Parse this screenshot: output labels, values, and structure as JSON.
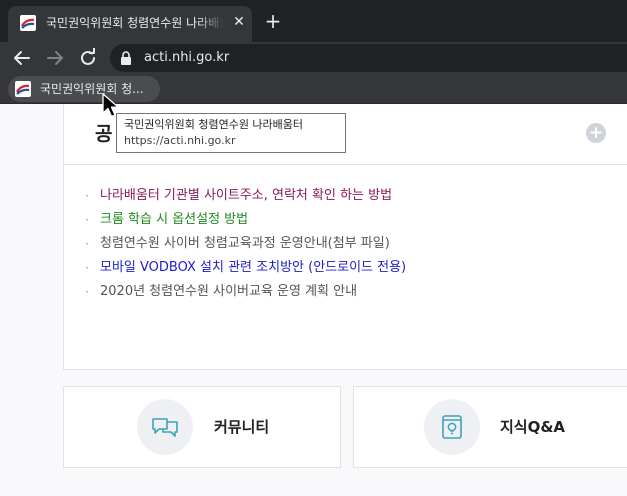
{
  "browser": {
    "tab": {
      "title": "국민권익위원회 청렴연수원 나라배움터",
      "close_glyph": "✕"
    },
    "new_tab_glyph": "+",
    "address": {
      "url": "acti.nhi.go.kr"
    },
    "bookmark": {
      "label": "국민권익위원회 청..."
    },
    "tooltip": {
      "title": "국민권익위원회 청렴연수원 나라배움터",
      "url": "https://acti.nhi.go.kr"
    }
  },
  "notice": {
    "title": "공",
    "more_glyph": "+",
    "items": [
      {
        "text": "나라배움터 기관별 사이트주소, 연락처 확인 하는 방법",
        "color": "#8b1a5c"
      },
      {
        "text": "크롬 학습 시 옵션설정 방법",
        "color": "#1f8a1f"
      },
      {
        "text": "청렴연수원 사이버 청렴교육과정 운영안내(첨부 파일)",
        "color": "#555555"
      },
      {
        "text": "모바일 VODBOX 설치 관련 조치방안 (안드로이드 전용)",
        "color": "#1c1ccc"
      },
      {
        "text": "2020년 청렴연수원 사이버교육 운영 계획 안내",
        "color": "#555555"
      }
    ],
    "bullet": "·"
  },
  "cards": {
    "community": {
      "label": "커뮤니티",
      "icon": "chat-bubbles-icon"
    },
    "qna": {
      "label": "지식Q&A",
      "icon": "book-lightbulb-icon"
    }
  },
  "colors": {
    "chrome_dark": "#202124",
    "chrome_toolbar": "#35363a",
    "icon_teal": "#3fa3b8"
  }
}
